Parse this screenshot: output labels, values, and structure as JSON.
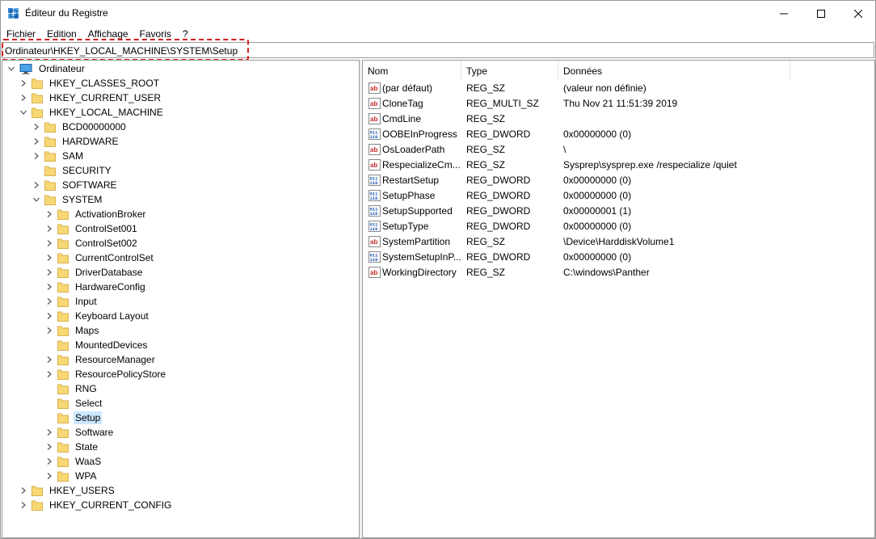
{
  "window": {
    "title": "Éditeur du Registre"
  },
  "colors": {
    "accent_selected": "#cce8ff",
    "highlight_border": "#d81f1f",
    "folder_yellow": "#f8d775",
    "string_icon_red": "#c62828",
    "dword_icon_blue": "#1a56b5"
  },
  "menu": {
    "items": [
      "Fichier",
      "Edition",
      "Affichage",
      "Favoris",
      "?"
    ]
  },
  "address": {
    "path": "Ordinateur\\HKEY_LOCAL_MACHINE\\SYSTEM\\Setup"
  },
  "tree": {
    "root": "Ordinateur",
    "hives": {
      "classes_root": "HKEY_CLASSES_ROOT",
      "current_user": "HKEY_CURRENT_USER",
      "local_machine": "HKEY_LOCAL_MACHINE",
      "users": "HKEY_USERS",
      "current_config": "HKEY_CURRENT_CONFIG"
    },
    "local_machine_children": {
      "bcd": "BCD00000000",
      "hardware": "HARDWARE",
      "sam": "SAM",
      "security": "SECURITY",
      "software": "SOFTWARE",
      "system": "SYSTEM"
    },
    "system_children": [
      "ActivationBroker",
      "ControlSet001",
      "ControlSet002",
      "CurrentControlSet",
      "DriverDatabase",
      "HardwareConfig",
      "Input",
      "Keyboard Layout",
      "Maps",
      "MountedDevices",
      "ResourceManager",
      "ResourcePolicyStore",
      "RNG",
      "Select",
      "Setup",
      "Software",
      "State",
      "WaaS",
      "WPA"
    ],
    "selected": "Setup"
  },
  "values": {
    "columns": [
      "Nom",
      "Type",
      "Données"
    ],
    "rows": [
      {
        "name": "(par défaut)",
        "type": "REG_SZ",
        "data": "(valeur non définie)",
        "icon": "string-icon"
      },
      {
        "name": "CloneTag",
        "type": "REG_MULTI_SZ",
        "data": "Thu Nov 21 11:51:39 2019",
        "icon": "string-icon"
      },
      {
        "name": "CmdLine",
        "type": "REG_SZ",
        "data": "",
        "icon": "string-icon"
      },
      {
        "name": "OOBEInProgress",
        "type": "REG_DWORD",
        "data": "0x00000000 (0)",
        "icon": "binary-icon"
      },
      {
        "name": "OsLoaderPath",
        "type": "REG_SZ",
        "data": "\\",
        "icon": "string-icon"
      },
      {
        "name": "RespecializeCm...",
        "type": "REG_SZ",
        "data": "Sysprep\\sysprep.exe /respecialize /quiet",
        "icon": "string-icon"
      },
      {
        "name": "RestartSetup",
        "type": "REG_DWORD",
        "data": "0x00000000 (0)",
        "icon": "binary-icon"
      },
      {
        "name": "SetupPhase",
        "type": "REG_DWORD",
        "data": "0x00000000 (0)",
        "icon": "binary-icon"
      },
      {
        "name": "SetupSupported",
        "type": "REG_DWORD",
        "data": "0x00000001 (1)",
        "icon": "binary-icon"
      },
      {
        "name": "SetupType",
        "type": "REG_DWORD",
        "data": "0x00000000 (0)",
        "icon": "binary-icon"
      },
      {
        "name": "SystemPartition",
        "type": "REG_SZ",
        "data": "\\Device\\HarddiskVolume1",
        "icon": "string-icon"
      },
      {
        "name": "SystemSetupInP...",
        "type": "REG_DWORD",
        "data": "0x00000000 (0)",
        "icon": "binary-icon"
      },
      {
        "name": "WorkingDirectory",
        "type": "REG_SZ",
        "data": "C:\\windows\\Panther",
        "icon": "string-icon"
      }
    ]
  }
}
